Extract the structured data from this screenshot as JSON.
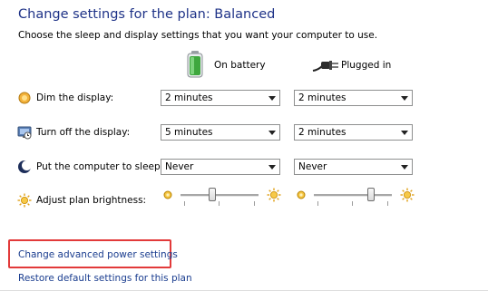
{
  "header": {
    "title": "Change settings for the plan: Balanced",
    "subtitle": "Choose the sleep and display settings that you want your computer to use."
  },
  "columns": {
    "battery_label": "On battery",
    "plugged_label": "Plugged in",
    "battery_icon": "battery-icon",
    "plugged_icon": "power-plug-icon"
  },
  "rows": {
    "dim": {
      "label": "Dim the display:",
      "icon": "dim-display-icon",
      "battery_value": "2 minutes",
      "plugged_value": "2 minutes"
    },
    "off": {
      "label": "Turn off the display:",
      "icon": "display-off-icon",
      "battery_value": "5 minutes",
      "plugged_value": "2 minutes"
    },
    "sleep": {
      "label": "Put the computer to sleep:",
      "icon": "sleep-moon-icon",
      "battery_value": "Never",
      "plugged_value": "Never"
    },
    "brightness": {
      "label": "Adjust plan brightness:",
      "icon": "brightness-sun-icon",
      "battery_level": 0.4,
      "plugged_level": 0.75
    }
  },
  "links": {
    "advanced": "Change advanced power settings",
    "restore": "Restore default settings for this plan"
  },
  "colors": {
    "title": "#1e3287",
    "link": "#1a3d8f",
    "highlight": "#e23a3a"
  }
}
